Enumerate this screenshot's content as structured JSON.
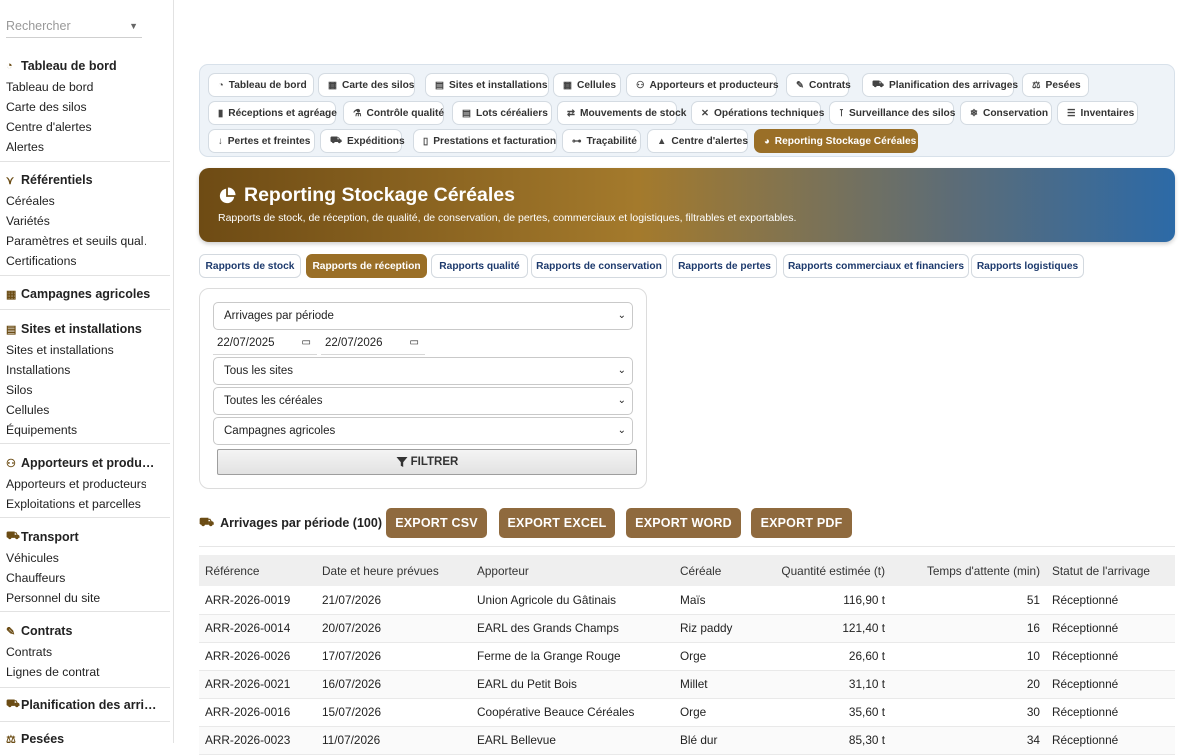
{
  "sidebar": {
    "search_placeholder": "Rechercher",
    "sections": [
      {
        "title": "Tableau de bord",
        "icon": "gauge-icon",
        "items": [
          "Tableau de bord",
          "Carte des silos",
          "Centre d'alertes",
          "Alertes"
        ]
      },
      {
        "title": "Référentiels",
        "icon": "wheat-icon",
        "items": [
          "Céréales",
          "Variétés",
          "Paramètres et seuils qual…",
          "Certifications"
        ]
      },
      {
        "title": "Campagnes agricoles",
        "icon": "calendar-icon",
        "items": []
      },
      {
        "title": "Sites et installations",
        "icon": "warehouse-icon",
        "items": [
          "Sites et installations",
          "Installations",
          "Silos",
          "Cellules",
          "Équipements"
        ]
      },
      {
        "title": "Apporteurs et produ…",
        "icon": "users-icon",
        "items": [
          "Apporteurs et producteurs",
          "Exploitations et parcelles"
        ]
      },
      {
        "title": "Transport",
        "icon": "truck-icon",
        "items": [
          "Véhicules",
          "Chauffeurs",
          "Personnel du site"
        ]
      },
      {
        "title": "Contrats",
        "icon": "contract-icon",
        "items": [
          "Contrats",
          "Lignes de contrat"
        ]
      },
      {
        "title": "Planification des arri…",
        "icon": "truck-ramp-icon",
        "items": []
      },
      {
        "title": "Pesées",
        "icon": "scale-icon",
        "items": []
      }
    ]
  },
  "topnav": [
    {
      "label": "Tableau de bord",
      "icon": "gauge-icon"
    },
    {
      "label": "Carte des silos",
      "icon": "grid-icon"
    },
    {
      "label": "Sites et installations",
      "icon": "warehouse-icon"
    },
    {
      "label": "Cellules",
      "icon": "grid-icon"
    },
    {
      "label": "Apporteurs et producteurs",
      "icon": "users-icon"
    },
    {
      "label": "Contrats",
      "icon": "contract-icon"
    },
    {
      "label": "Planification des arrivages",
      "icon": "truck-ramp-icon"
    },
    {
      "label": "Pesées",
      "icon": "scale-icon"
    },
    {
      "label": "Réceptions et agréage",
      "icon": "clipboard-icon"
    },
    {
      "label": "Contrôle qualité",
      "icon": "flask-icon"
    },
    {
      "label": "Lots céréaliers",
      "icon": "boxes-icon"
    },
    {
      "label": "Mouvements de stock",
      "icon": "arrows-icon"
    },
    {
      "label": "Opérations techniques",
      "icon": "tools-icon"
    },
    {
      "label": "Surveillance des silos",
      "icon": "thermometer-icon"
    },
    {
      "label": "Conservation",
      "icon": "snowflake-icon"
    },
    {
      "label": "Inventaires",
      "icon": "list-icon"
    },
    {
      "label": "Pertes et freintes",
      "icon": "arrow-down-icon"
    },
    {
      "label": "Expéditions",
      "icon": "truck-icon"
    },
    {
      "label": "Prestations et facturation",
      "icon": "invoice-icon"
    },
    {
      "label": "Traçabilité",
      "icon": "sitemap-icon"
    },
    {
      "label": "Centre d'alertes",
      "icon": "bell-icon"
    },
    {
      "label": "Reporting Stockage Céréales",
      "icon": "pie-icon",
      "active": true
    }
  ],
  "banner": {
    "title": "Reporting Stockage Céréales",
    "subtitle": "Rapports de stock, de réception, de qualité, de conservation, de pertes, commerciaux et logistiques, filtrables et exportables."
  },
  "tabs": [
    "Rapports de stock",
    "Rapports de réception",
    "Rapports qualité",
    "Rapports de conservation",
    "Rapports de pertes",
    "Rapports commerciaux et financiers",
    "Rapports logistiques"
  ],
  "active_tab": 1,
  "filters": {
    "report": "Arrivages par période",
    "date_from": "22/07/2025",
    "date_to": "22/07/2026",
    "site": "Tous les sites",
    "cereal": "Toutes les céréales",
    "campaign": "Campagnes agricoles",
    "filter_button": "FILTRER"
  },
  "report": {
    "title": "Arrivages par période (100)",
    "exports": [
      "EXPORT CSV",
      "EXPORT EXCEL",
      "EXPORT WORD",
      "EXPORT PDF"
    ]
  },
  "table": {
    "columns": [
      "Référence",
      "Date et heure prévues",
      "Apporteur",
      "Céréale",
      "Quantité estimée (t)",
      "Temps d'attente (min)",
      "Statut de l'arrivage"
    ],
    "rows": [
      [
        "ARR-2026-0019",
        "21/07/2026",
        "Union Agricole du Gâtinais",
        "Maïs",
        "116,90 t",
        "51",
        "Réceptionné"
      ],
      [
        "ARR-2026-0014",
        "20/07/2026",
        "EARL des Grands Champs",
        "Riz paddy",
        "121,40 t",
        "16",
        "Réceptionné"
      ],
      [
        "ARR-2026-0026",
        "17/07/2026",
        "Ferme de la Grange Rouge",
        "Orge",
        "26,60 t",
        "10",
        "Réceptionné"
      ],
      [
        "ARR-2026-0021",
        "16/07/2026",
        "EARL du Petit Bois",
        "Millet",
        "31,10 t",
        "20",
        "Réceptionné"
      ],
      [
        "ARR-2026-0016",
        "15/07/2026",
        "Coopérative Beauce Céréales",
        "Orge",
        "35,60 t",
        "30",
        "Réceptionné"
      ],
      [
        "ARR-2026-0023",
        "11/07/2026",
        "EARL Bellevue",
        "Blé dur",
        "85,30 t",
        "34",
        "Réceptionné"
      ]
    ]
  },
  "colors": {
    "accent": "#9a6f27",
    "export": "#8f6a3e",
    "tab_text": "#1d3a6d"
  }
}
